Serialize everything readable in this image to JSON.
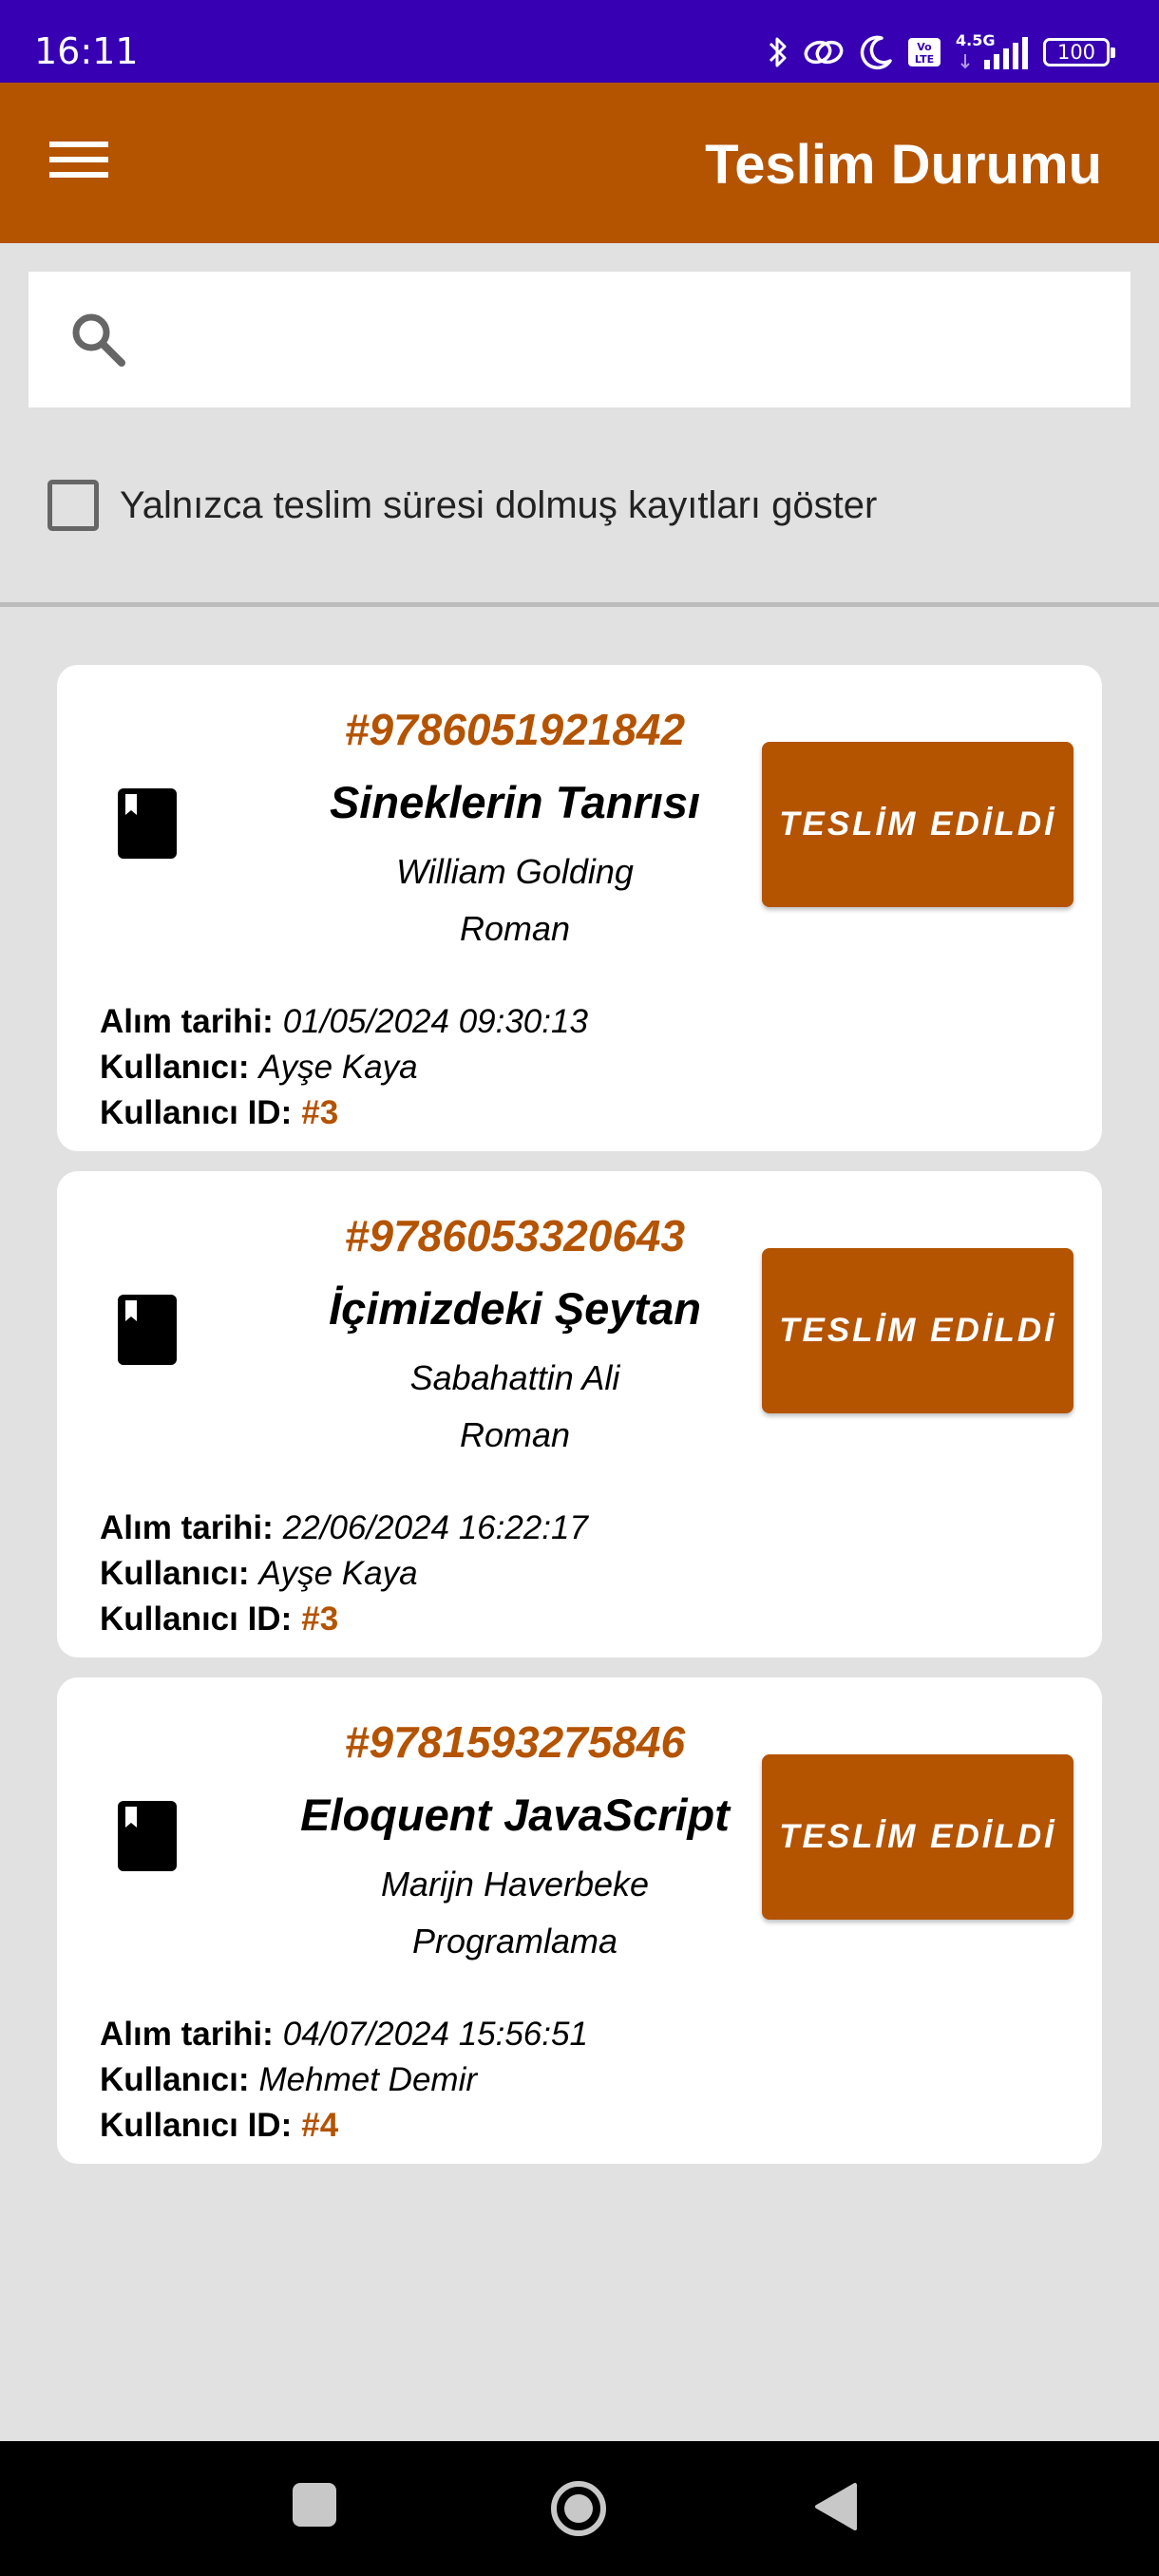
{
  "status_bar": {
    "time": "16:11",
    "network_label": "4.5G",
    "battery_level": "100",
    "icons": [
      "bluetooth-icon",
      "link-icon",
      "moon-icon",
      "volte-icon",
      "signal-icon",
      "battery-icon"
    ]
  },
  "app_bar": {
    "title": "Teslim Durumu",
    "menu_icon": "menu-icon"
  },
  "search": {
    "placeholder": "",
    "value": "",
    "icon": "search-icon"
  },
  "filter": {
    "label": "Yalnızca teslim süresi dolmuş kayıtları göster",
    "checked": false
  },
  "colors": {
    "status_bar": "#3700b3",
    "accent": "#b45300",
    "background": "#e1e1e1"
  },
  "loans": [
    {
      "isbn": "#9786051921842",
      "title": "Sineklerin Tanrısı",
      "author": "William Golding",
      "genre": "Roman",
      "button_label": "TESLİM EDİLDİ",
      "date_label": "Alım tarihi:",
      "date_value": "01/05/2024 09:30:13",
      "user_label": "Kullanıcı:",
      "user_value": "Ayşe Kaya",
      "user_id_label": "Kullanıcı ID:",
      "user_id_value": "#3"
    },
    {
      "isbn": "#9786053320643",
      "title": "İçimizdeki Şeytan",
      "author": "Sabahattin Ali",
      "genre": "Roman",
      "button_label": "TESLİM EDİLDİ",
      "date_label": "Alım tarihi:",
      "date_value": "22/06/2024 16:22:17",
      "user_label": "Kullanıcı:",
      "user_value": "Ayşe Kaya",
      "user_id_label": "Kullanıcı ID:",
      "user_id_value": "#3"
    },
    {
      "isbn": "#9781593275846",
      "title": "Eloquent JavaScript",
      "author": "Marijn Haverbeke",
      "genre": "Programlama",
      "button_label": "TESLİM EDİLDİ",
      "date_label": "Alım tarihi:",
      "date_value": "04/07/2024 15:56:51",
      "user_label": "Kullanıcı:",
      "user_value": "Mehmet Demir",
      "user_id_label": "Kullanıcı ID:",
      "user_id_value": "#4"
    }
  ],
  "nav_bar": {
    "icons": [
      "recents-icon",
      "home-icon",
      "back-icon"
    ]
  }
}
